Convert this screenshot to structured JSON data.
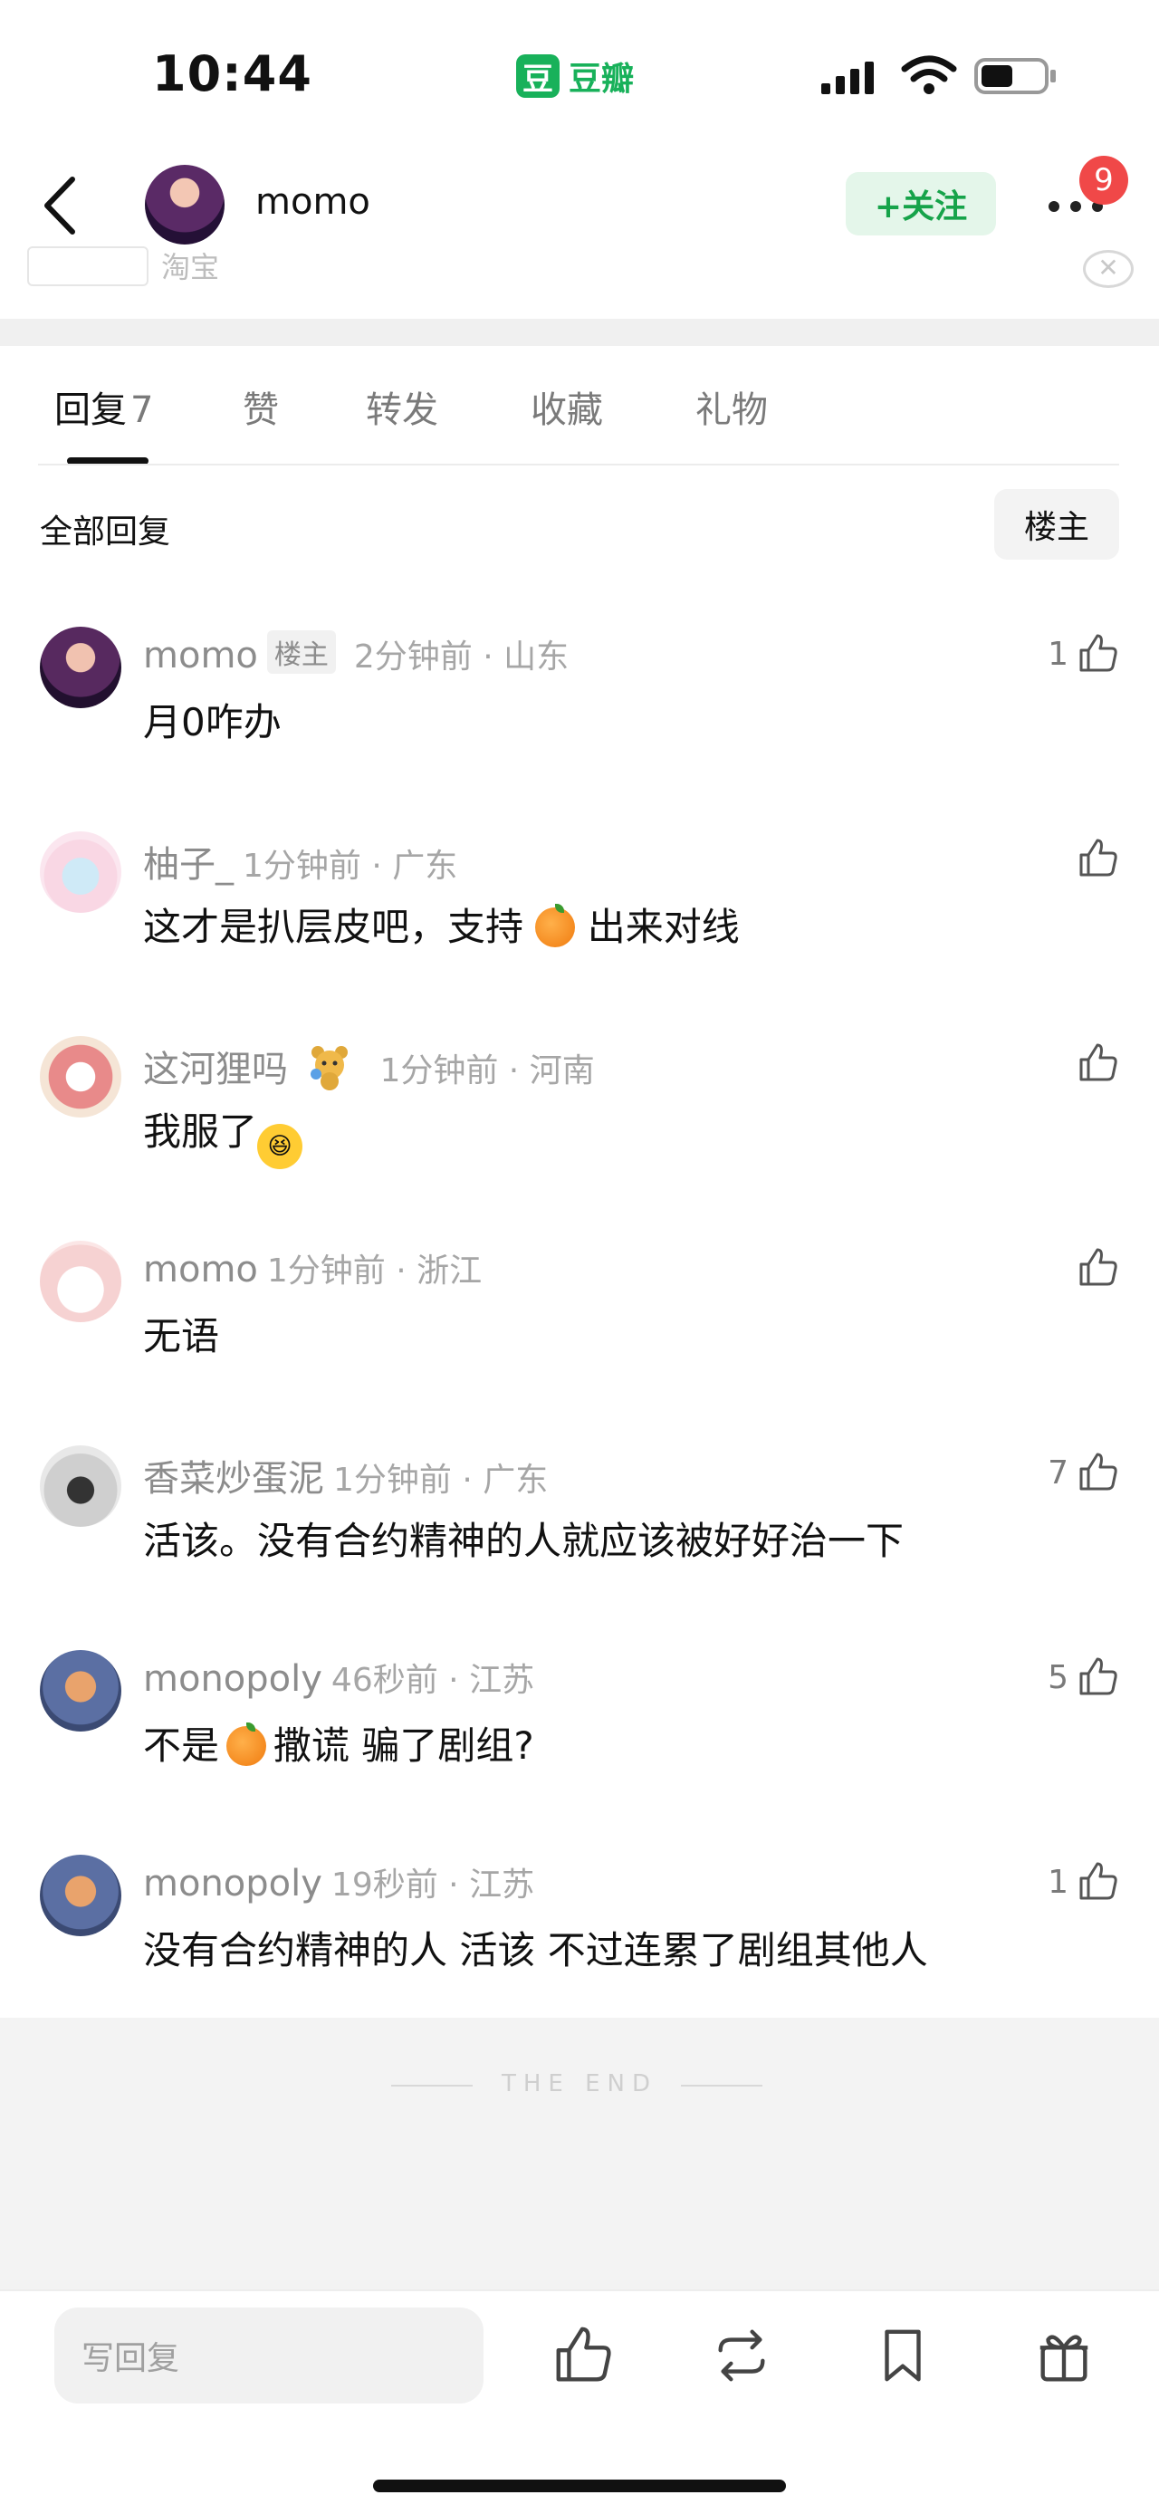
{
  "status_bar": {
    "time": "10:44",
    "app_name": "豆瓣",
    "app_logo": "豆",
    "icons": [
      "signal-icon",
      "wifi-icon",
      "battery-icon"
    ]
  },
  "header": {
    "username": "momo",
    "follow_label": "+关注",
    "notification_count": "9"
  },
  "peek": {
    "text": "淘宝"
  },
  "tabs": [
    {
      "label": "回复",
      "count": "7",
      "active": true
    },
    {
      "label": "赞"
    },
    {
      "label": "转发"
    },
    {
      "label": "收藏"
    },
    {
      "label": "礼物"
    }
  ],
  "filter": {
    "all_replies": "全部回复",
    "owner_button": "楼主"
  },
  "comments": [
    {
      "user": "momo",
      "tag": "楼主",
      "time": "2分钟前",
      "location": "山东",
      "text": "月0咋办",
      "likes": "1"
    },
    {
      "user": "柚子_",
      "time": "1分钟前",
      "location": "广东",
      "text_before": "这才是扒层皮吧，支持",
      "emoji": "orange",
      "text_after": "出来对线",
      "likes": ""
    },
    {
      "user": "这河狸吗",
      "time": "1分钟前",
      "location": "河南",
      "text": "我服了",
      "emoji": "laughing",
      "likes": ""
    },
    {
      "user": "momo",
      "time": "1分钟前",
      "location": "浙江",
      "text": "无语",
      "likes": ""
    },
    {
      "user": "香菜炒蛋泥",
      "time": "1分钟前",
      "location": "广东",
      "text": "活该。没有合约精神的人就应该被好好治一下",
      "likes": "7"
    },
    {
      "user": "monopoly",
      "time": "46秒前",
      "location": "江苏",
      "text_before": "不是",
      "emoji": "orange",
      "text_after": "撒谎 骗了剧组?",
      "likes": "5"
    },
    {
      "user": "monopoly",
      "time": "19秒前",
      "location": "江苏",
      "text": "没有合约精神的人 活该 不过连累了剧组其他人",
      "likes": "1"
    }
  ],
  "end_text": "THE END",
  "bottom_bar": {
    "reply_placeholder": "写回复",
    "icons": [
      "like-icon",
      "repost-icon",
      "bookmark-icon",
      "gift-icon"
    ]
  },
  "colors": {
    "accent_green": "#16a34a",
    "follow_bg": "#e4f6ea",
    "badge_red": "#f04848"
  }
}
